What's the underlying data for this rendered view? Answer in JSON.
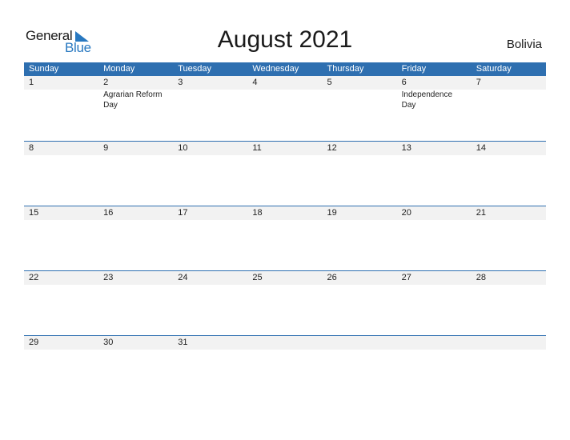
{
  "logo": {
    "general": "General",
    "blue": "Blue"
  },
  "title": "August 2021",
  "country": "Bolivia",
  "weekdays": [
    "Sunday",
    "Monday",
    "Tuesday",
    "Wednesday",
    "Thursday",
    "Friday",
    "Saturday"
  ],
  "weeks": [
    {
      "days": [
        "1",
        "2",
        "3",
        "4",
        "5",
        "6",
        "7"
      ],
      "events": [
        "",
        "Agrarian Reform Day",
        "",
        "",
        "",
        "Independence Day",
        ""
      ]
    },
    {
      "days": [
        "8",
        "9",
        "10",
        "11",
        "12",
        "13",
        "14"
      ],
      "events": [
        "",
        "",
        "",
        "",
        "",
        "",
        ""
      ]
    },
    {
      "days": [
        "15",
        "16",
        "17",
        "18",
        "19",
        "20",
        "21"
      ],
      "events": [
        "",
        "",
        "",
        "",
        "",
        "",
        ""
      ]
    },
    {
      "days": [
        "22",
        "23",
        "24",
        "25",
        "26",
        "27",
        "28"
      ],
      "events": [
        "",
        "",
        "",
        "",
        "",
        "",
        ""
      ]
    },
    {
      "days": [
        "29",
        "30",
        "31",
        "",
        "",
        "",
        ""
      ],
      "events": [
        "",
        "",
        "",
        "",
        "",
        "",
        ""
      ]
    }
  ]
}
